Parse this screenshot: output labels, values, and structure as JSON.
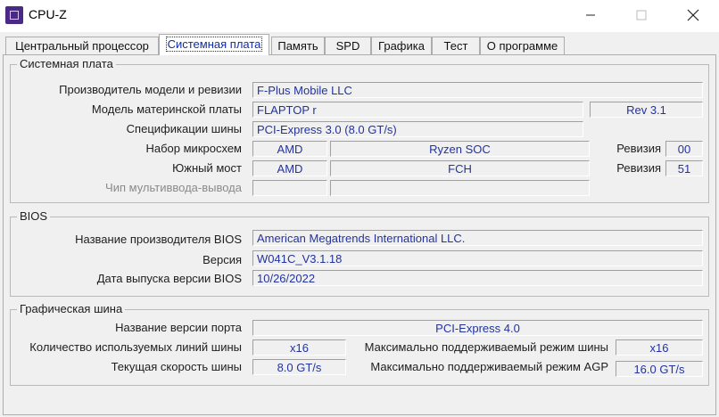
{
  "window": {
    "title": "CPU-Z"
  },
  "tabs": [
    {
      "label": "Центральный процессор"
    },
    {
      "label": "Системная плата"
    },
    {
      "label": "Память"
    },
    {
      "label": "SPD"
    },
    {
      "label": "Графика"
    },
    {
      "label": "Тест"
    },
    {
      "label": "О программе"
    }
  ],
  "motherboard": {
    "group_title": "Системная плата",
    "manufacturer_label": "Производитель модели и ревизии",
    "manufacturer_value": "F-Plus Mobile LLC",
    "model_label": "Модель материнской платы",
    "model_value": "FLAPTOP r",
    "model_rev": "Rev 3.1",
    "bus_label": "Спецификации шины",
    "bus_value": "PCI-Express 3.0 (8.0 GT/s)",
    "chipset_label": "Набор микросхем",
    "chipset_vendor": "AMD",
    "chipset_model": "Ryzen SOC",
    "chipset_rev_label": "Ревизия",
    "chipset_rev": "00",
    "southbridge_label": "Южный мост",
    "southbridge_vendor": "AMD",
    "southbridge_model": "FCH",
    "southbridge_rev_label": "Ревизия",
    "southbridge_rev": "51",
    "lpcio_label": "Чип мультиввода-вывода"
  },
  "bios": {
    "group_title": "BIOS",
    "brand_label": "Название производителя BIOS",
    "brand_value": "American Megatrends International LLC.",
    "version_label": "Версия",
    "version_value": "W041C_V3.1.18",
    "date_label": "Дата выпуска версии BIOS",
    "date_value": "10/26/2022"
  },
  "graphic": {
    "group_title": "Графическая шина",
    "port_label": "Название версии порта",
    "port_value": "PCI-Express 4.0",
    "lanes_label": "Количество используемых линий шины",
    "lanes_value": "x16",
    "max_mode_label": "Максимально поддерживаемый режим шины",
    "max_mode_value": "x16",
    "speed_label": "Текущая скорость шины",
    "speed_value": "8.0 GT/s",
    "max_agp_label": "Максимально поддерживаемый режим AGP",
    "max_agp_value": "16.0 GT/s"
  }
}
